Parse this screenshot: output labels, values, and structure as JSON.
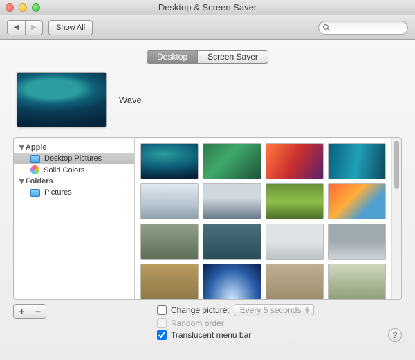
{
  "window": {
    "title": "Desktop & Screen Saver"
  },
  "toolbar": {
    "back_label": "◀",
    "forward_label": "▶",
    "show_all": "Show All",
    "search_placeholder": ""
  },
  "tabs": {
    "desktop": "Desktop",
    "screensaver": "Screen Saver",
    "active": "desktop"
  },
  "current_wallpaper": {
    "name": "Wave"
  },
  "sidebar": {
    "groups": [
      {
        "label": "Apple",
        "items": [
          {
            "label": "Desktop Pictures",
            "icon": "folder",
            "selected": true
          },
          {
            "label": "Solid Colors",
            "icon": "color-wheel",
            "selected": false
          }
        ]
      },
      {
        "label": "Folders",
        "items": [
          {
            "label": "Pictures",
            "icon": "folder",
            "selected": false
          }
        ]
      }
    ]
  },
  "thumbnails": [
    "t1",
    "t2",
    "t3",
    "t4",
    "t5",
    "t6",
    "t7",
    "t8",
    "t9",
    "t10",
    "t11",
    "t12",
    "t13",
    "t14",
    "t15",
    "t16"
  ],
  "footer": {
    "add": "+",
    "remove": "−",
    "change_picture_label": "Change picture:",
    "change_picture_interval": "Every 5 seconds",
    "change_picture_checked": false,
    "random_order_label": "Random order",
    "random_order_checked": false,
    "translucent_label": "Translucent menu bar",
    "translucent_checked": true,
    "help": "?"
  }
}
